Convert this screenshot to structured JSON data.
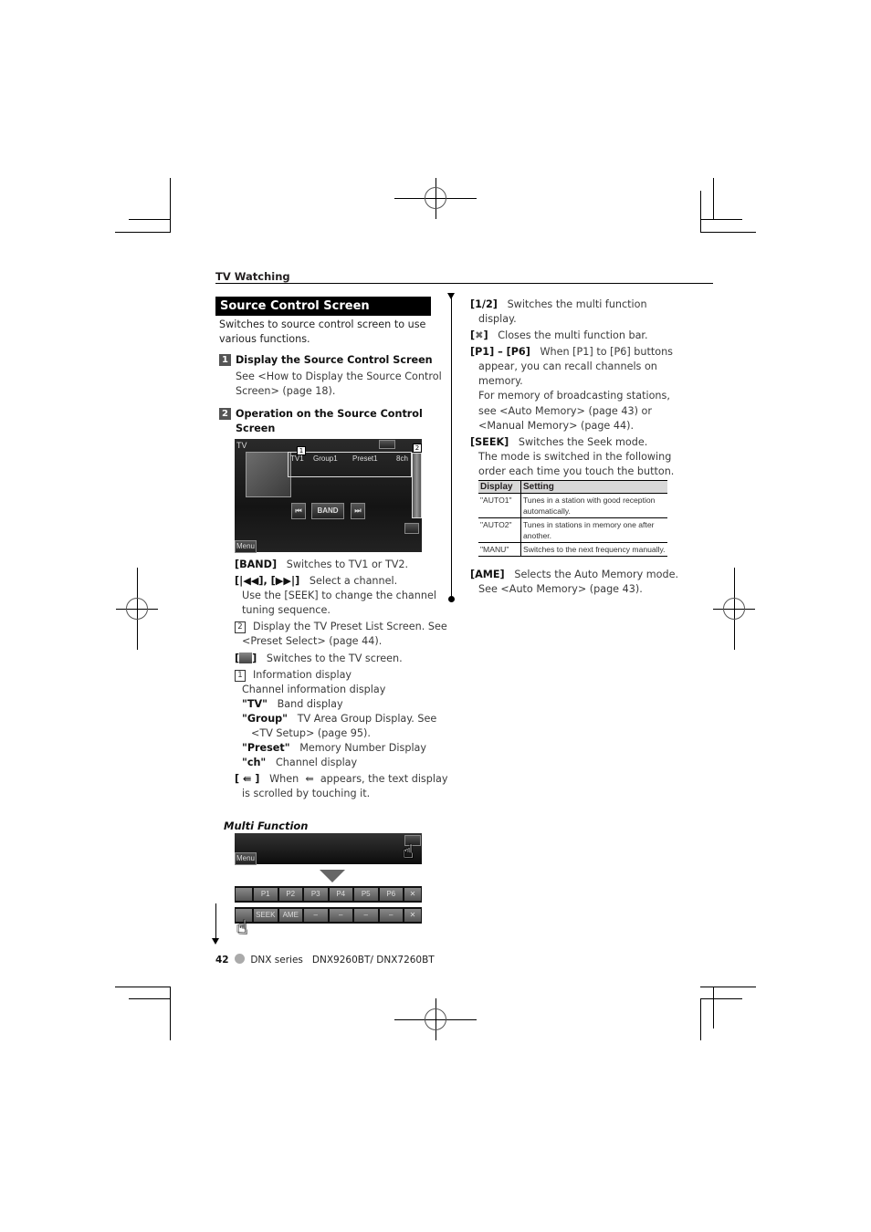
{
  "header": {
    "section": "TV Watching"
  },
  "left": {
    "title": "Source Control Screen",
    "intro": [
      "Switches to source control screen to use",
      "various functions."
    ],
    "step1": {
      "num": "1",
      "title": "Display the Source Control Screen",
      "body": [
        "See <How to Display the Source Control",
        "Screen> (page 18)."
      ]
    },
    "step2": {
      "num": "2",
      "title": [
        "Operation on the Source Control",
        "Screen"
      ]
    },
    "screen": {
      "band": "TV",
      "info": {
        "band": "TV1",
        "group": "Group1",
        "preset": "Preset1",
        "channel": "8ch"
      },
      "callout1": "1",
      "callout2": "2",
      "prev_icon": "prev-track-icon",
      "band_btn": "BAND",
      "next_icon": "next-track-icon",
      "menu_btn": "Menu"
    },
    "desc": {
      "band": {
        "key": "[BAND]",
        "text": "Switches to TV1 or TV2."
      },
      "seek": {
        "key": "[|◀◀], [▶▶|]",
        "text": "Select a channel.",
        "more": [
          "Use the [SEEK] to change the channel",
          "tuning sequence."
        ]
      },
      "preset": {
        "num": "2",
        "text": "Display the TV Preset List Screen. See",
        "more": "<Preset Select> (page 44)."
      },
      "tvscreen": {
        "text": "Switches to the TV screen."
      },
      "info": {
        "num": "1",
        "text": "Information display",
        "sub": "Channel information display"
      },
      "info_items": [
        {
          "key": "\"TV\"",
          "text": "Band display"
        },
        {
          "key": "\"Group\"",
          "text": "TV Area Group Display. See",
          "more": "<TV Setup> (page 95)."
        },
        {
          "key": "\"Preset\"",
          "text": "Memory Number Display"
        },
        {
          "key": "\"ch\"",
          "text": "Channel display"
        }
      ],
      "scroll": {
        "key": "[ ⇚ ]",
        "text1": "When",
        "text2": "appears, the text display",
        "more": "is scrolled by touching it."
      }
    },
    "multi": {
      "title": "Multi Function",
      "menu": "Menu",
      "row1": [
        "P1",
        "P2",
        "P3",
        "P4",
        "P5",
        "P6"
      ],
      "row2": [
        "SEEK",
        "AME",
        "–",
        "–",
        "–",
        "–"
      ]
    }
  },
  "right": {
    "half": {
      "key": "[1/2]",
      "text": "Switches the multi function",
      "more": "display."
    },
    "close": {
      "text": "Closes the multi function bar."
    },
    "p": {
      "key": "[P1] – [P6]",
      "text": "When [P1] to [P6] buttons",
      "more": [
        "appear,  you can recall channels on",
        "memory.",
        "For memory of broadcasting stations,",
        "see <Auto Memory> (page 43) or",
        "<Manual Memory> (page 44)."
      ]
    },
    "seek": {
      "key": "[SEEK]",
      "text": "Switches the Seek mode.",
      "more": [
        "The mode is switched in the following",
        "order each time you touch the button."
      ]
    },
    "table": {
      "headers": [
        "Display",
        "Setting"
      ],
      "rows": [
        [
          "\"AUTO1\"",
          "Tunes in a station with good reception automatically."
        ],
        [
          "\"AUTO2\"",
          "Tunes in stations in memory one after another."
        ],
        [
          "\"MANU\"",
          "Switches to the next frequency manually."
        ]
      ]
    },
    "ame": {
      "key": "[AME]",
      "text": "Selects the Auto Memory mode.",
      "more": "See <Auto Memory> (page 43)."
    }
  },
  "footer": {
    "page": "42",
    "series": "DNX series",
    "models": "DNX9260BT/ DNX7260BT"
  }
}
